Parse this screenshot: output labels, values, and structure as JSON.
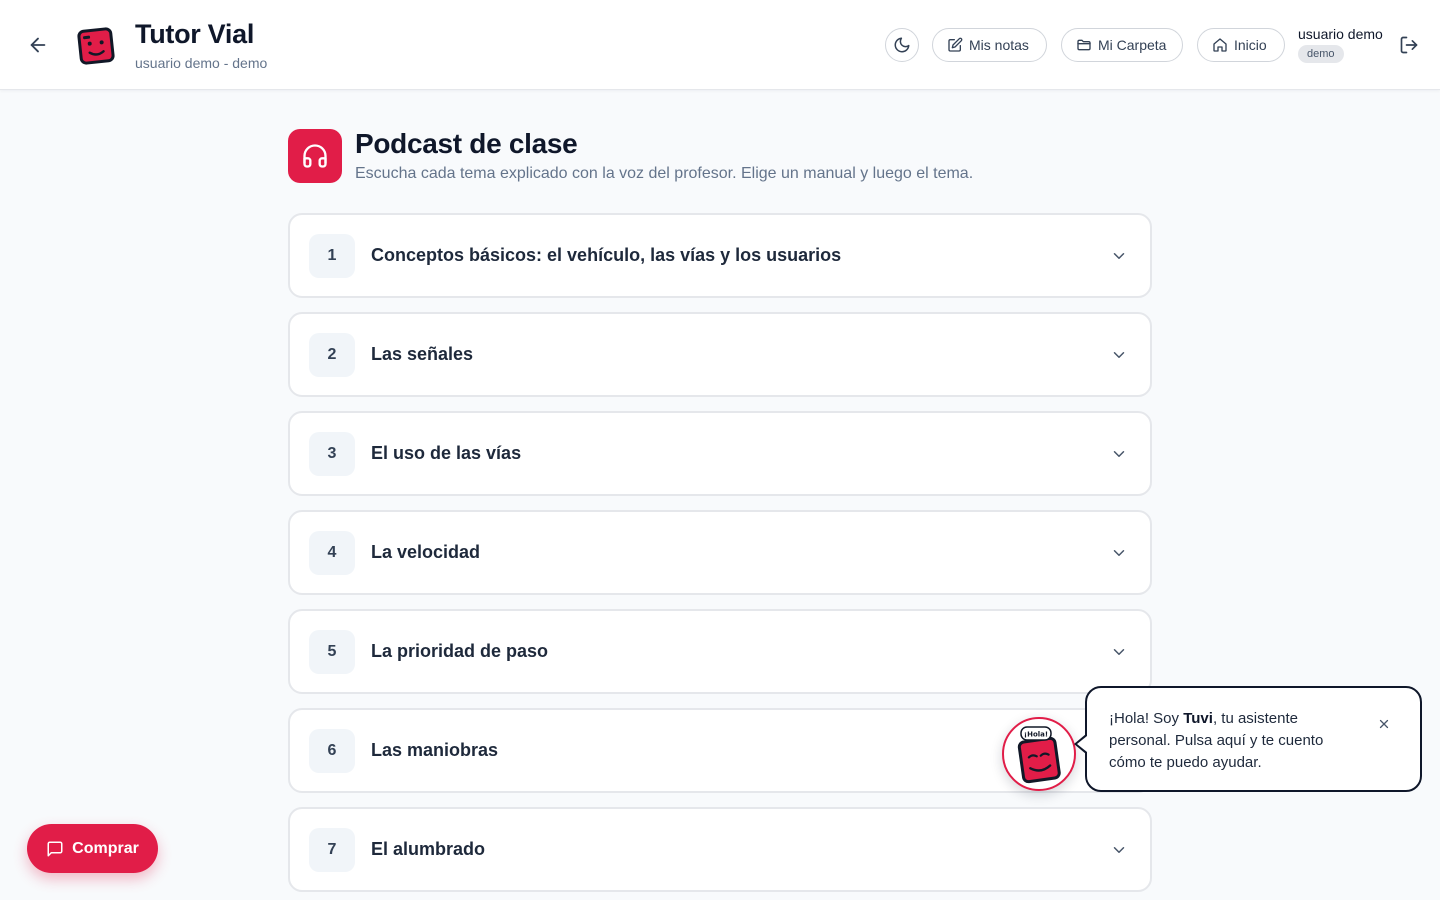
{
  "header": {
    "brand_title": "Tutor Vial",
    "brand_subtitle": "usuario demo - demo",
    "nav": {
      "notas_label": "Mis notas",
      "carpeta_label": "Mi Carpeta",
      "inicio_label": "Inicio"
    },
    "user": {
      "name": "usuario demo",
      "badge": "demo"
    }
  },
  "page": {
    "title": "Podcast de clase",
    "subtitle": "Escucha cada tema explicado con la voz del profesor. Elige un manual y luego el tema."
  },
  "topics": [
    {
      "number": "1",
      "title": "Conceptos básicos: el vehículo, las vías y los usuarios"
    },
    {
      "number": "2",
      "title": "Las señales"
    },
    {
      "number": "3",
      "title": "El uso de las vías"
    },
    {
      "number": "4",
      "title": "La velocidad"
    },
    {
      "number": "5",
      "title": "La prioridad de paso"
    },
    {
      "number": "6",
      "title": "Las maniobras"
    },
    {
      "number": "7",
      "title": "El alumbrado"
    }
  ],
  "buy_button": {
    "label": "Comprar"
  },
  "assistant": {
    "greeting_prefix": "¡Hola! Soy ",
    "name": "Tuvi",
    "greeting_suffix": ", tu asistente personal. Pulsa aquí y te cuento cómo te puedo ayudar.",
    "avatar_caption": "¡Hola!"
  },
  "colors": {
    "accent": "#e11d48",
    "text": "#0f172a",
    "muted": "#64748b",
    "border": "#e5e7eb",
    "background": "#f8fafc"
  },
  "icons": {
    "back": "arrow-left-icon",
    "theme": "moon-icon",
    "notas": "edit-note-icon",
    "carpeta": "folder-icon",
    "inicio": "home-icon",
    "logout": "logout-icon",
    "page": "headphones-icon",
    "topic_toggle": "chevron-down-icon",
    "buy": "chat-icon",
    "close": "close-icon"
  }
}
